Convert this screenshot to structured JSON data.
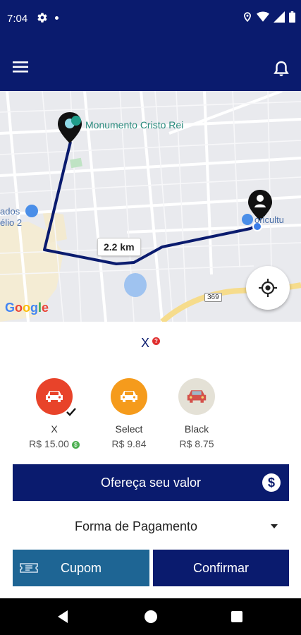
{
  "status_bar": {
    "time": "7:04"
  },
  "map": {
    "destination_label": "Monumento Cristo Rei",
    "left_label_line1": "ados",
    "left_label_line2": "élio 2",
    "right_label": "oricultu",
    "distance": "2.2 km",
    "road_number": "369",
    "attribution": [
      "G",
      "o",
      "o",
      "g",
      "l",
      "e"
    ]
  },
  "selected_category": {
    "label": "X",
    "badge": "?"
  },
  "car_options": [
    {
      "name": "X",
      "price": "R$ 15.00",
      "color": "#e8432a",
      "selected": true
    },
    {
      "name": "Select",
      "price": "R$ 9.84",
      "color": "#f59b1c",
      "selected": false
    },
    {
      "name": "Black",
      "price": "R$ 8.75",
      "color": "#e4e1d6",
      "selected": false
    }
  ],
  "offer_button": {
    "label": "Ofereça seu valor",
    "icon": "$"
  },
  "payment": {
    "label": "Forma de Pagamento"
  },
  "coupon_button": {
    "label": "Cupom"
  },
  "confirm_button": {
    "label": "Confirmar"
  },
  "colors": {
    "primary": "#0a1b6e",
    "secondary": "#1e6594",
    "route": "#0a1b6e"
  }
}
